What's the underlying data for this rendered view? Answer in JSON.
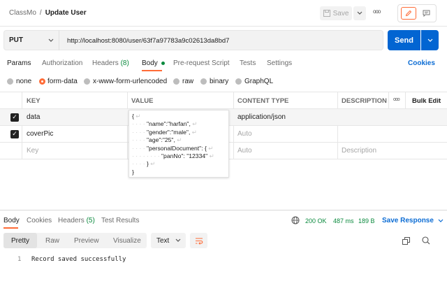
{
  "header": {
    "workspace": "ClassMo",
    "separator": "/",
    "title": "Update User",
    "save_label": "Save",
    "more": "ooo"
  },
  "request": {
    "method": "PUT",
    "url": "http://localhost:8080/user/63f7a97783a9c02613da8bd7",
    "send_label": "Send",
    "cookies_label": "Cookies"
  },
  "req_tabs": {
    "params": "Params",
    "authorization": "Authorization",
    "headers": "Headers",
    "headers_count": "(8)",
    "body": "Body",
    "pre_request": "Pre-request Script",
    "tests": "Tests",
    "settings": "Settings"
  },
  "body_types": {
    "none": "none",
    "form_data": "form-data",
    "urlencoded": "x-www-form-urlencoded",
    "raw": "raw",
    "binary": "binary",
    "graphql": "GraphQL",
    "selected": "form-data"
  },
  "form_table": {
    "headers": {
      "key": "KEY",
      "value": "VALUE",
      "content_type": "CONTENT TYPE",
      "description": "DESCRIPTION",
      "more": "ooo",
      "bulk_edit": "Bulk Edit"
    },
    "rows": [
      {
        "key": "data",
        "content_type": "application/json",
        "description": ""
      },
      {
        "key": "coverPic",
        "content_type": "Auto",
        "description": ""
      }
    ],
    "placeholder": {
      "key": "Key",
      "content_type": "Auto",
      "description": "Description"
    }
  },
  "value_editor": {
    "lines": [
      {
        "indent": "",
        "text": "{"
      },
      {
        "indent": "· · · · ",
        "text": "\"name\":\"harfan\","
      },
      {
        "indent": "· · · · ",
        "text": "\"gender\":\"male\","
      },
      {
        "indent": "· · · · ",
        "text": "\"age\":\"25\","
      },
      {
        "indent": "· · · · ",
        "text": "\"personalDocument\": {"
      },
      {
        "indent": "· · · · · · · · ",
        "text": "\"panNo\": \"12334\""
      },
      {
        "indent": "· · · · ",
        "text": "}"
      },
      {
        "indent": "",
        "text": "}"
      }
    ],
    "line_end": "↵"
  },
  "response": {
    "tabs": {
      "body": "Body",
      "cookies": "Cookies",
      "headers": "Headers",
      "headers_count": "(5)",
      "test_results": "Test Results"
    },
    "status": "200 OK",
    "time": "487 ms",
    "size": "189 B",
    "save_response": "Save Response",
    "view_tabs": {
      "pretty": "Pretty",
      "raw": "Raw",
      "preview": "Preview",
      "visualize": "Visualize"
    },
    "format": "Text",
    "lines": [
      {
        "num": "1",
        "text": "Record saved successfully"
      }
    ]
  },
  "colors": {
    "accent": "#ff6c37",
    "send_blue": "#0265d2",
    "link_blue": "#0b6cd4",
    "status_green": "#0b8a3e"
  },
  "icons": {
    "save": "save-icon",
    "edit": "pencil-icon",
    "comments": "comment-icon",
    "globe": "globe-icon",
    "copy": "copy-icon",
    "search": "search-icon",
    "wrap": "wrap-icon"
  }
}
